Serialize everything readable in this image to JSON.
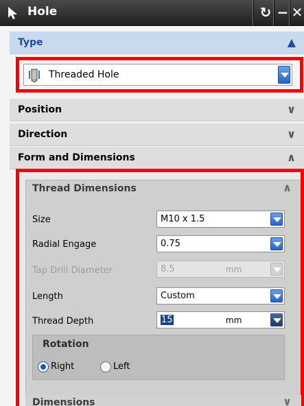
{
  "window": {
    "title": "Hole"
  },
  "sections": {
    "type": {
      "label": "Type"
    },
    "position": {
      "label": "Position"
    },
    "direction": {
      "label": "Direction"
    },
    "form": {
      "label": "Form and Dimensions"
    }
  },
  "type_select": {
    "value": "Threaded Hole"
  },
  "thread": {
    "title": "Thread Dimensions",
    "size": {
      "label": "Size",
      "value": "M10 x 1.5"
    },
    "radial": {
      "label": "Radial Engage",
      "value": "0.75"
    },
    "tapdrill": {
      "label": "Tap Drill Diameter",
      "value": "8.5",
      "unit": "mm"
    },
    "length": {
      "label": "Length",
      "value": "Custom"
    },
    "depth": {
      "label": "Thread Depth",
      "value": "15",
      "unit": "mm"
    }
  },
  "rotation": {
    "title": "Rotation",
    "options": [
      "Right",
      "Left"
    ],
    "selected": "Right"
  },
  "dimensions": {
    "label": "Dimensions"
  },
  "colors": {
    "highlight_border": "#ff0000",
    "accent": "#1d4e96"
  }
}
